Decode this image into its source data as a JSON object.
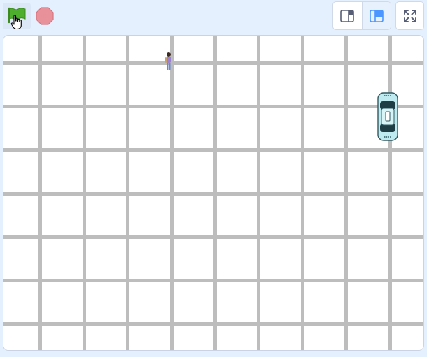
{
  "toolbar": {
    "green_flag": {
      "icon": "green-flag-icon",
      "color": "#4cae2c"
    },
    "stop": {
      "icon": "stop-sign-icon",
      "color": "#e8919a"
    },
    "layout": {
      "small_stage": {
        "icon": "small-stage-layout-icon"
      },
      "large_stage": {
        "icon": "large-stage-layout-icon",
        "selected": true
      }
    },
    "fullscreen": {
      "icon": "fullscreen-icon"
    }
  },
  "stage": {
    "background_color": "#ffffff",
    "road_color": "#bdbdbd",
    "sprites": [
      {
        "name": "person",
        "icon": "person-sprite"
      },
      {
        "name": "taxi",
        "icon": "taxi-car-sprite",
        "color": "#bfeaef"
      }
    ]
  }
}
